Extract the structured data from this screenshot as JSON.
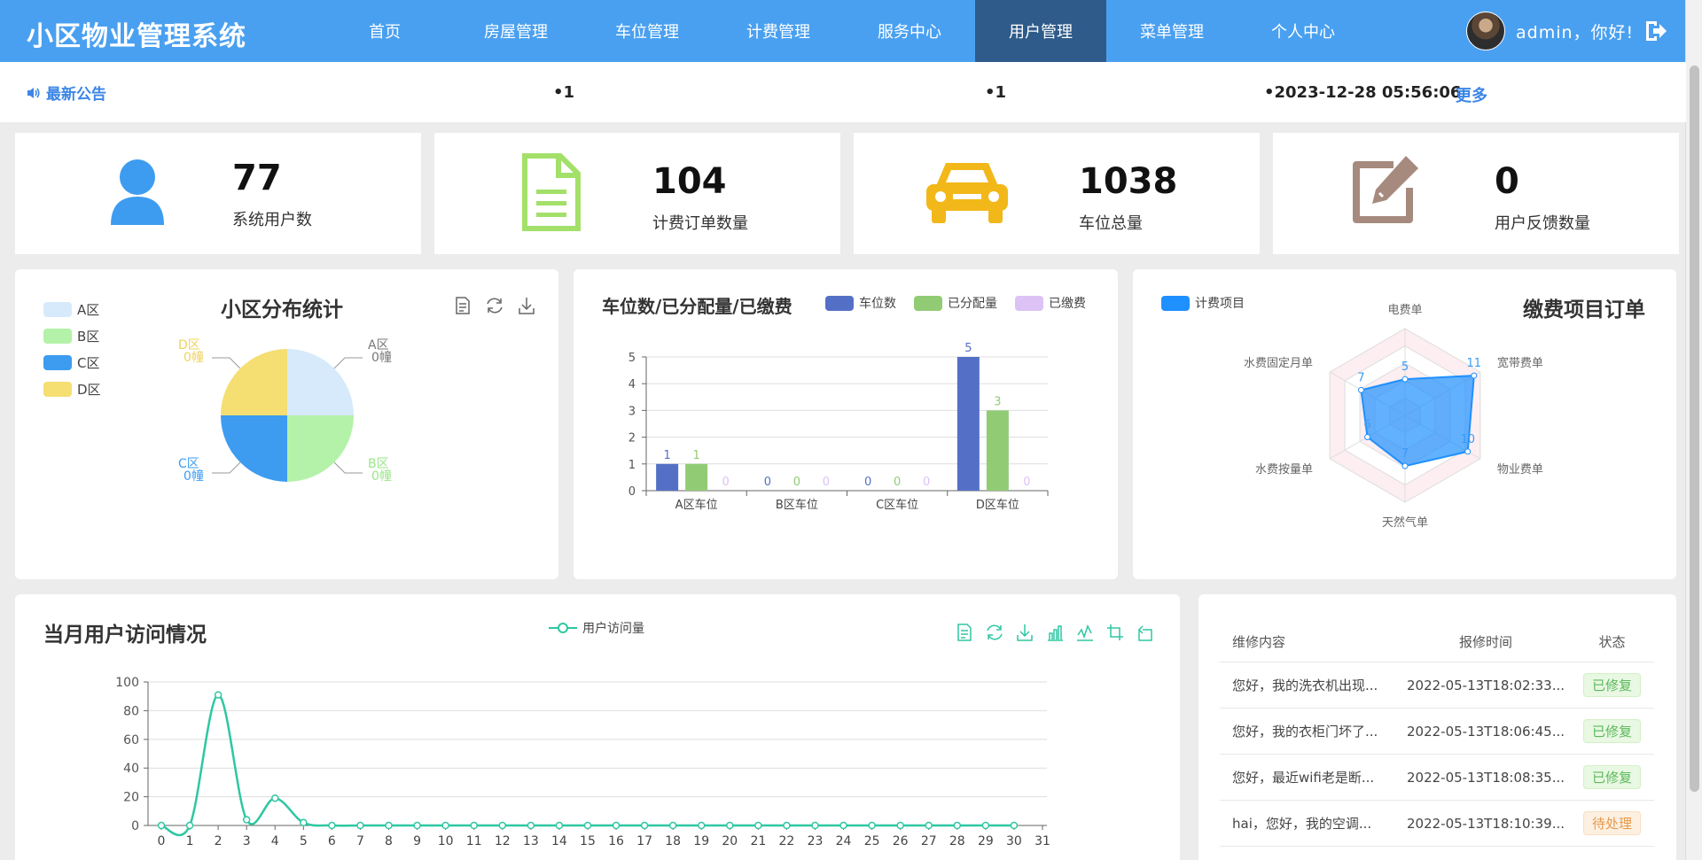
{
  "app": {
    "title": "小区物业管理系统",
    "nav": [
      {
        "label": "首页"
      },
      {
        "label": "房屋管理"
      },
      {
        "label": "车位管理"
      },
      {
        "label": "计费管理"
      },
      {
        "label": "服务中心"
      },
      {
        "label": "用户管理",
        "active": true
      },
      {
        "label": "菜单管理"
      },
      {
        "label": "个人中心"
      }
    ],
    "greeting": "admin，你好!",
    "accent": "#4aa0f0",
    "active_nav_bg": "#2f5b8a"
  },
  "notice": {
    "title": "最新公告",
    "items": [
      "•1",
      "•1",
      "•2023-12-28 05:56:06"
    ],
    "more": "更多"
  },
  "stats": [
    {
      "value": "77",
      "label": "系统用户数",
      "icon": "user-icon",
      "color": "#3d9cf0"
    },
    {
      "value": "104",
      "label": "计费订单数量",
      "icon": "document-icon",
      "color": "#a3e06a"
    },
    {
      "value": "1038",
      "label": "车位总量",
      "icon": "car-icon",
      "color": "#f2b81a"
    },
    {
      "value": "0",
      "label": "用户反馈数量",
      "icon": "edit-icon",
      "color": "#a68a7e"
    }
  ],
  "pie_panel": {
    "title": "小区分布统计",
    "chart_data": {
      "type": "pie",
      "title": "小区分布统计",
      "slices": [
        {
          "name": "A区",
          "value": 0,
          "label": "0幢",
          "color": "#d7eafb"
        },
        {
          "name": "B区",
          "value": 0,
          "label": "0幢",
          "color": "#b3f2a8"
        },
        {
          "name": "C区",
          "value": 0,
          "label": "0幢",
          "color": "#3d9cf0"
        },
        {
          "name": "D区",
          "value": 0,
          "label": "0幢",
          "color": "#f5de72"
        }
      ],
      "legend": "top-left"
    }
  },
  "bar_panel": {
    "title": "车位数/已分配量/已缴费",
    "chart_data": {
      "type": "bar",
      "title": "车位数/已分配量/已缴费",
      "categories": [
        "A区车位",
        "B区车位",
        "C区车位",
        "D区车位"
      ],
      "series": [
        {
          "name": "车位数",
          "values": [
            1,
            0,
            0,
            5
          ],
          "color": "#5470c6"
        },
        {
          "name": "已分配量",
          "values": [
            1,
            0,
            0,
            3
          ],
          "color": "#91cc75"
        },
        {
          "name": "已缴费",
          "values": [
            0,
            0,
            0,
            0
          ],
          "color": "#dcc2f5"
        }
      ],
      "ylim": [
        0,
        5
      ],
      "yticks": [
        "0",
        "1",
        "2",
        "3",
        "4",
        "5"
      ],
      "grid": true,
      "legend": "top-right"
    }
  },
  "radar_panel": {
    "title": "缴费项目订单",
    "chart_data": {
      "type": "radar",
      "title": "缴费项目订单",
      "series": [
        {
          "name": "计费项目",
          "color": "#1e90ff"
        }
      ],
      "indicators": [
        "电费单",
        "宽带费单",
        "物业费单",
        "天然气单",
        "水费按量单",
        "水费固定月单"
      ],
      "values": [
        5,
        11,
        10,
        7,
        6,
        7
      ],
      "max": 12,
      "legend": "top-left"
    }
  },
  "line_panel": {
    "title": "当月用户访问情况",
    "chart_data": {
      "type": "line",
      "title": "当月用户访问情况",
      "series": [
        {
          "name": "用户访问量",
          "color": "#2ec7a2",
          "values": [
            0,
            0,
            91,
            4,
            19,
            2,
            0,
            0,
            0,
            0,
            0,
            0,
            0,
            0,
            0,
            0,
            0,
            0,
            0,
            0,
            0,
            0,
            0,
            0,
            0,
            0,
            0,
            0,
            0,
            0,
            0
          ]
        }
      ],
      "x": [
        "0",
        "1",
        "2",
        "3",
        "4",
        "5",
        "6",
        "7",
        "8",
        "9",
        "10",
        "11",
        "12",
        "13",
        "14",
        "15",
        "16",
        "17",
        "18",
        "19",
        "20",
        "21",
        "22",
        "23",
        "24",
        "25",
        "26",
        "27",
        "28",
        "29",
        "30",
        "31"
      ],
      "ylim": [
        0,
        100
      ],
      "yticks": [
        "0",
        "20",
        "40",
        "60",
        "80",
        "100"
      ],
      "grid": true,
      "legend": "top-center"
    }
  },
  "repair": {
    "headers": [
      "维修内容",
      "报修时间",
      "状态"
    ],
    "rows": [
      {
        "content": "您好，我的洗衣机出现...",
        "time": "2022-05-13T18:02:33...",
        "status": "已修复",
        "kind": "ok"
      },
      {
        "content": "您好，我的衣柜门坏了...",
        "time": "2022-05-13T18:06:45...",
        "status": "已修复",
        "kind": "ok"
      },
      {
        "content": "您好，最近wifi老是断...",
        "time": "2022-05-13T18:08:35...",
        "status": "已修复",
        "kind": "ok"
      },
      {
        "content": "hai，您好，我的空调...",
        "time": "2022-05-13T18:10:39...",
        "status": "待处理",
        "kind": "wait"
      }
    ]
  }
}
